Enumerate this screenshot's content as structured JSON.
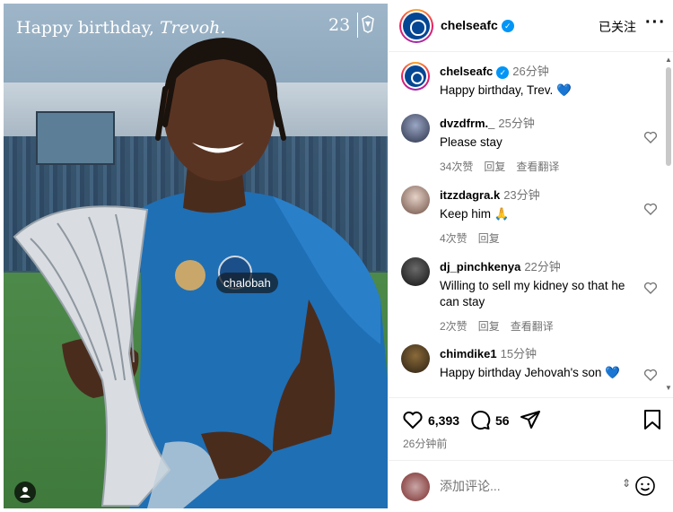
{
  "post": {
    "caption_prefix": "Happy birthday, ",
    "caption_name": "Trevoh.",
    "number": "23",
    "player_tag": "chalobah"
  },
  "header": {
    "username": "chelseafc",
    "follow_label": "已关注",
    "more_label": "···"
  },
  "caption": {
    "username": "chelseafc",
    "time": "26分钟",
    "text": "Happy birthday, Trev. 💙"
  },
  "comments": [
    {
      "user": "dvzdfrm._",
      "time": "25分钟",
      "text": "Please stay",
      "likes": "34次赞",
      "reply": "回复",
      "translate": "查看翻译"
    },
    {
      "user": "itzzdagra.k",
      "time": "23分钟",
      "text": "Keep him 🙏",
      "likes": "4次赞",
      "reply": "回复",
      "translate": ""
    },
    {
      "user": "dj_pinchkenya",
      "time": "22分钟",
      "text": "Willing to sell my kidney so that he can stay",
      "likes": "2次赞",
      "reply": "回复",
      "translate": "查看翻译"
    },
    {
      "user": "chimdike1",
      "time": "15分钟",
      "text": "Happy birthday Jehovah's son 💙",
      "likes": "",
      "reply": "",
      "translate": ""
    }
  ],
  "actions": {
    "likes": "6,393",
    "comments": "56",
    "posted": "26分钟前"
  },
  "composer": {
    "placeholder": "添加评论..."
  },
  "colors": {
    "verified": "#0095f6",
    "brand": "#034694"
  }
}
